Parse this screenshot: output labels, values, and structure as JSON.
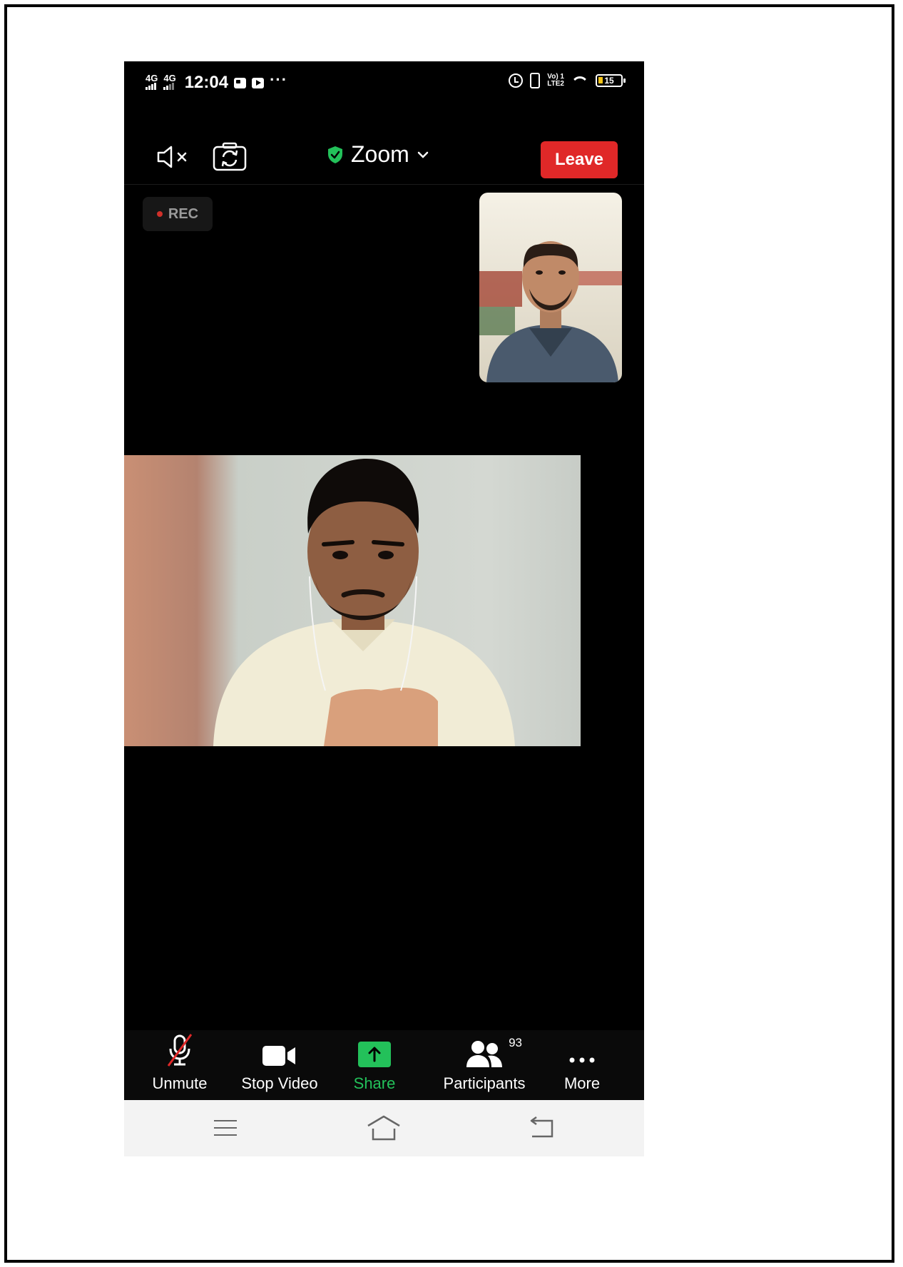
{
  "status_bar": {
    "signal_1": "4G",
    "signal_2": "4G",
    "time": "12:04",
    "more_indicator": "···",
    "volte_line1": "Vo) 1",
    "volte_line2": "LTE2",
    "battery_level": "15",
    "icons": [
      "signal-icon",
      "gallery-notification-icon",
      "youtube-notification-icon",
      "alarm-icon",
      "vibrate-icon",
      "wifi-icon",
      "battery-icon"
    ]
  },
  "top_bar": {
    "speaker_icon": "speaker-muted-icon",
    "camera_icon": "switch-camera-icon",
    "meeting_title": "Zoom",
    "title_chevron": "⌄",
    "leave_label": "Leave",
    "shield_color": "#23c15a",
    "leave_color": "#e02828"
  },
  "recording": {
    "label": "REC"
  },
  "videos": {
    "thumbnail": "participant-thumbnail-video",
    "main": "active-speaker-video"
  },
  "toolbar": {
    "items": [
      {
        "label": "Unmute",
        "icon": "mic-muted-icon"
      },
      {
        "label": "Stop Video",
        "icon": "video-camera-icon"
      },
      {
        "label": "Share",
        "icon": "share-arrow-icon"
      },
      {
        "label": "Participants",
        "icon": "participants-icon",
        "badge": "93"
      },
      {
        "label": "More",
        "icon": "more-dots-icon"
      }
    ],
    "share_color": "#23c15a"
  },
  "nav_bar": {
    "icons": [
      "menu-icon",
      "home-icon",
      "back-icon"
    ]
  }
}
